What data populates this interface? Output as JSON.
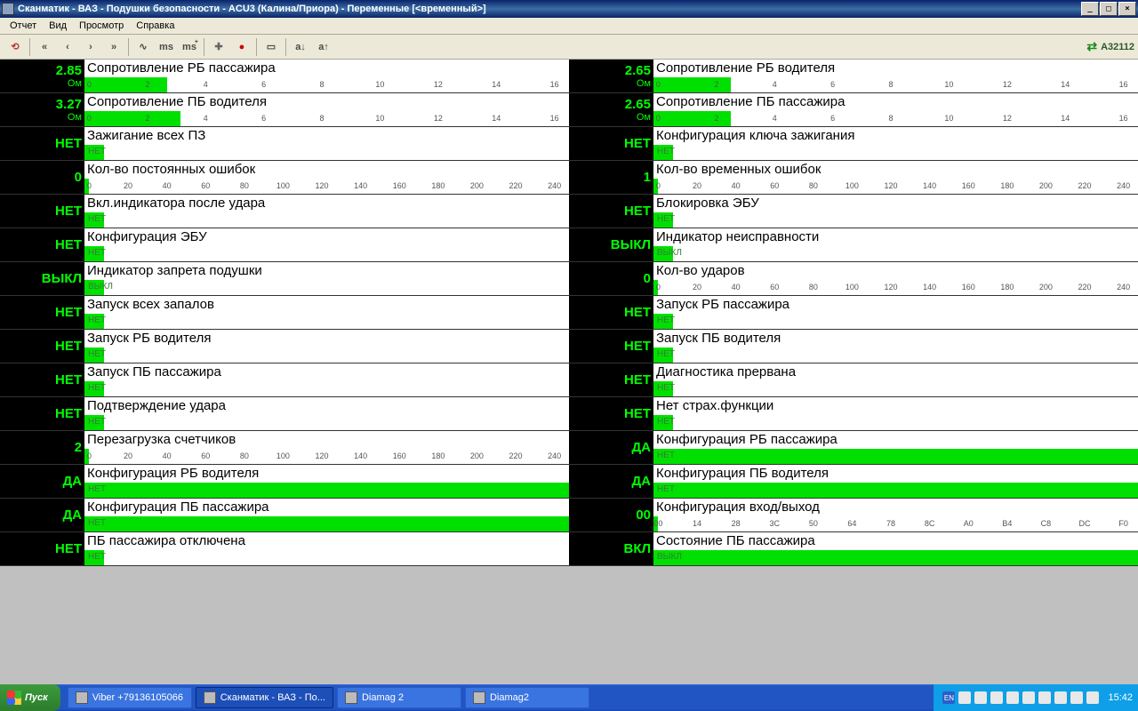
{
  "window": {
    "title": "Сканматик - ВАЗ - Подушки безопасности - ACU3 (Калина/Приора) - Переменные [<временный>]",
    "btn_min": "_",
    "btn_max": "□",
    "btn_close": "×"
  },
  "menu": {
    "report": "Отчет",
    "view": "Вид",
    "browse": "Просмотр",
    "help": "Справка"
  },
  "toolbar": {
    "buttons": [
      "↶",
      "|",
      "«",
      "‹",
      "›",
      "»",
      "|",
      "∿",
      "ms",
      "ms+",
      "|",
      "✚",
      "●",
      "|",
      "▭",
      "|",
      "a↓",
      "a↑"
    ],
    "status_code": "A32112"
  },
  "scales": {
    "s6": [
      "0",
      "2",
      "4",
      "6",
      "8",
      "10",
      "12",
      "14",
      "16"
    ],
    "s240": [
      "0",
      "20",
      "40",
      "60",
      "80",
      "100",
      "120",
      "140",
      "160",
      "180",
      "200",
      "220",
      "240"
    ],
    "shex": [
      "00",
      "14",
      "28",
      "3C",
      "50",
      "64",
      "78",
      "8C",
      "A0",
      "B4",
      "C8",
      "DC",
      "F0"
    ]
  },
  "left": [
    {
      "val": "2.85",
      "unit": "Ом",
      "label": "Сопротивление РБ пассажира",
      "type": "bar6",
      "fill": 0.45
    },
    {
      "val": "3.27",
      "unit": "Ом",
      "label": "Сопротивление ПБ водителя",
      "type": "bar6",
      "fill": 0.52
    },
    {
      "val": "НЕТ",
      "unit": "",
      "label": "Зажигание всех ПЗ",
      "type": "state",
      "state": "НЕТ"
    },
    {
      "val": "0",
      "unit": "",
      "label": "Кол-во постоянных ошибок",
      "type": "bar240",
      "fill": 0.0
    },
    {
      "val": "НЕТ",
      "unit": "",
      "label": "Вкл.индикатора после удара",
      "type": "state",
      "state": "НЕТ"
    },
    {
      "val": "НЕТ",
      "unit": "",
      "label": "Конфигурация ЭБУ",
      "type": "state",
      "state": "НЕТ"
    },
    {
      "val": "ВЫКЛ",
      "unit": "",
      "label": "Индикатор запрета подушки",
      "type": "state",
      "state": "ВЫКЛ"
    },
    {
      "val": "НЕТ",
      "unit": "",
      "label": "Запуск всех запалов",
      "type": "state",
      "state": "НЕТ"
    },
    {
      "val": "НЕТ",
      "unit": "",
      "label": "Запуск РБ водителя",
      "type": "state",
      "state": "НЕТ"
    },
    {
      "val": "НЕТ",
      "unit": "",
      "label": "Запуск ПБ пассажира",
      "type": "state",
      "state": "НЕТ"
    },
    {
      "val": "НЕТ",
      "unit": "",
      "label": "Подтверждение удара",
      "type": "state",
      "state": "НЕТ"
    },
    {
      "val": "2",
      "unit": "",
      "label": "Перезагрузка счетчиков",
      "type": "bar240",
      "fill": 0.01
    },
    {
      "val": "ДА",
      "unit": "",
      "label": "Конфигурация РБ водителя",
      "type": "full",
      "state": "НЕТ"
    },
    {
      "val": "ДА",
      "unit": "",
      "label": "Конфигурация ПБ пассажира",
      "type": "full",
      "state": "НЕТ"
    },
    {
      "val": "НЕТ",
      "unit": "",
      "label": "ПБ пассажира отключена",
      "type": "state",
      "state": "НЕТ"
    }
  ],
  "right": [
    {
      "val": "2.65",
      "unit": "Ом",
      "label": "Сопротивление РБ водителя",
      "type": "bar6",
      "fill": 0.42
    },
    {
      "val": "2.65",
      "unit": "Ом",
      "label": "Сопротивление ПБ пассажира",
      "type": "bar6",
      "fill": 0.42
    },
    {
      "val": "НЕТ",
      "unit": "",
      "label": "Конфигурация ключа зажигания",
      "type": "state",
      "state": "НЕТ"
    },
    {
      "val": "1",
      "unit": "",
      "label": "Кол-во временных ошибок",
      "type": "bar240",
      "fill": 0.005
    },
    {
      "val": "НЕТ",
      "unit": "",
      "label": "Блокировка ЭБУ",
      "type": "state",
      "state": "НЕТ"
    },
    {
      "val": "ВЫКЛ",
      "unit": "",
      "label": "Индикатор неисправности",
      "type": "state",
      "state": "ВЫКЛ"
    },
    {
      "val": "0",
      "unit": "",
      "label": "Кол-во ударов",
      "type": "bar240",
      "fill": 0.0
    },
    {
      "val": "НЕТ",
      "unit": "",
      "label": "Запуск РБ пассажира",
      "type": "state",
      "state": "НЕТ"
    },
    {
      "val": "НЕТ",
      "unit": "",
      "label": "Запуск ПБ водителя",
      "type": "state",
      "state": "НЕТ"
    },
    {
      "val": "НЕТ",
      "unit": "",
      "label": "Диагностика прервана",
      "type": "state",
      "state": "НЕТ"
    },
    {
      "val": "НЕТ",
      "unit": "",
      "label": "Нет страх.функции",
      "type": "state",
      "state": "НЕТ"
    },
    {
      "val": "ДА",
      "unit": "",
      "label": "Конфигурация РБ пассажира",
      "type": "full",
      "state": "НЕТ"
    },
    {
      "val": "ДА",
      "unit": "",
      "label": "Конфигурация ПБ водителя",
      "type": "full",
      "state": "НЕТ"
    },
    {
      "val": "00",
      "unit": "",
      "label": "Конфигурация вход/выход",
      "type": "barhex",
      "fill": 0.0
    },
    {
      "val": "ВКЛ",
      "unit": "",
      "label": "Состояние ПБ пассажира",
      "type": "full",
      "state": "ВЫКЛ"
    }
  ],
  "taskbar": {
    "start": "Пуск",
    "items": [
      {
        "label": "Viber +79136105066",
        "active": false
      },
      {
        "label": "Сканматик - ВАЗ - По...",
        "active": true
      },
      {
        "label": "Diamag 2",
        "active": false
      },
      {
        "label": "Diamag2",
        "active": false
      }
    ],
    "lang": "EN",
    "clock": "15:42"
  }
}
